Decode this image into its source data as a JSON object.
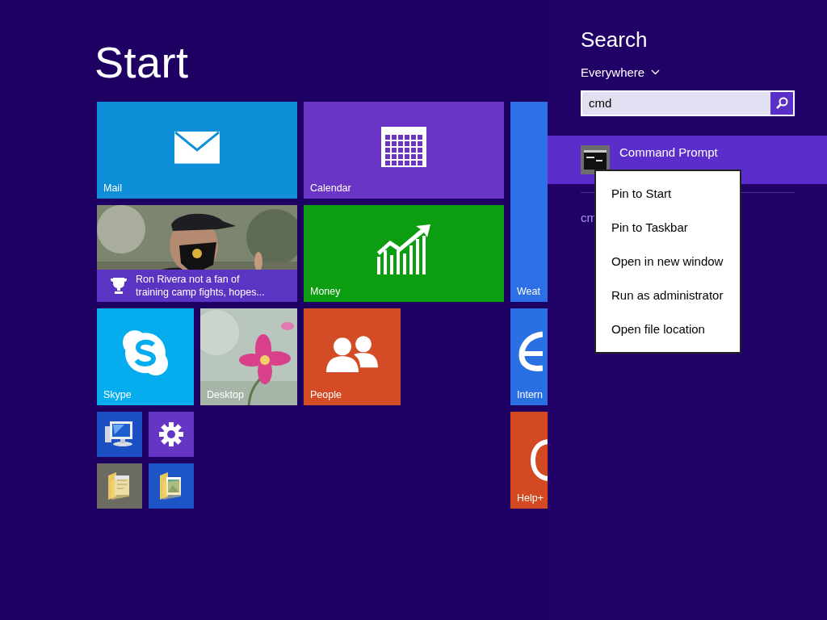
{
  "start": {
    "title": "Start",
    "tiles": [
      {
        "kind": "mail",
        "label": "Mail",
        "color": "#0f8ed8"
      },
      {
        "kind": "calendar",
        "label": "Calendar",
        "color": "#6a35c4"
      },
      {
        "kind": "news",
        "text": "Ron Rivera not a fan of training camp fights, hopes...",
        "color": "#5c34c4"
      },
      {
        "kind": "money",
        "label": "Money",
        "color": "#0c9e10"
      },
      {
        "kind": "weather",
        "label": "Weat",
        "color": "#2d6fe5"
      },
      {
        "kind": "skype",
        "label": "Skype",
        "color": "#05adef"
      },
      {
        "kind": "desktop",
        "label": "Desktop"
      },
      {
        "kind": "people",
        "label": "People",
        "color": "#d44c26"
      },
      {
        "kind": "internet",
        "label": "Intern",
        "color": "#2b70e2"
      },
      {
        "kind": "computer",
        "color": "#1d4fc4"
      },
      {
        "kind": "settings",
        "color": "#6536c4"
      },
      {
        "kind": "documents",
        "color": "#6b6b62"
      },
      {
        "kind": "pictures",
        "color": "#1d55c6"
      },
      {
        "kind": "help",
        "label": "Help+",
        "color": "#d34a22"
      }
    ]
  },
  "search_pane": {
    "title": "Search",
    "scope": "Everywhere",
    "query": "cmd",
    "results": [
      {
        "label": "Command Prompt",
        "selected": true
      }
    ],
    "suggestions": [
      "cm"
    ],
    "context_menu": [
      "Pin to Start",
      "Pin to Taskbar",
      "Open in new window",
      "Run as administrator",
      "Open file location"
    ]
  }
}
